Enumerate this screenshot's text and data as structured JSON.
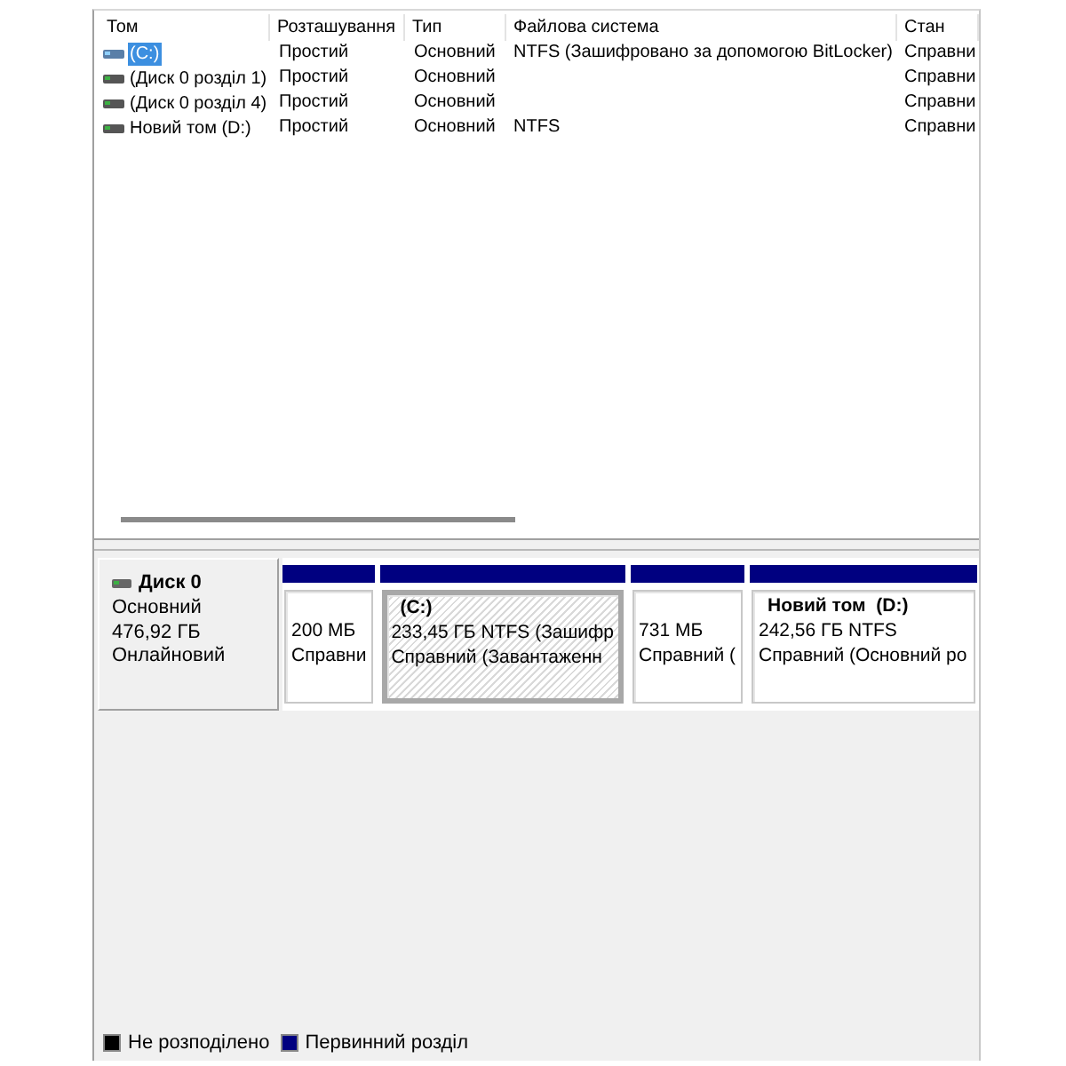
{
  "table": {
    "columns": [
      "Том",
      "Розташування",
      "Тип",
      "Файлова система",
      "Стан"
    ],
    "rows": [
      {
        "volume": "(C:)",
        "layout": "Простий",
        "type": "Основний",
        "file_system": "NTFS (Зашифровано за допомогою BitLocker)",
        "status": "Справни",
        "selected": true
      },
      {
        "volume": "(Диск 0 розділ 1)",
        "layout": "Простий",
        "type": "Основний",
        "status": "Справни",
        "selected": false
      },
      {
        "volume": "(Диск 0 розділ 4)",
        "layout": "Простий",
        "type": "Основний",
        "status": "Справни",
        "selected": false
      },
      {
        "volume": "Новий том (D:)",
        "layout": "Простий",
        "type": "Основний",
        "file_system": "NTFS",
        "status": "Справни",
        "selected": false
      }
    ]
  },
  "disks": [
    {
      "name": "Диск 0",
      "type": "Основний",
      "size": "476,92 ГБ",
      "state": "Онлайновий",
      "partitions": [
        {
          "lines": [
            "200 МБ",
            "Справни"
          ],
          "selected": false
        },
        {
          "title": "(C:)",
          "lines": [
            "233,45 ГБ NTFS (Зашифр",
            "Справний (Завантаженн"
          ],
          "selected": true
        },
        {
          "lines": [
            "731 МБ",
            "Справний ("
          ],
          "selected": false
        },
        {
          "title": "Новий том  (D:)",
          "lines": [
            "242,56 ГБ NTFS",
            "Справний (Основний ро"
          ],
          "selected": false
        }
      ]
    }
  ],
  "legend": [
    {
      "label": "Не розподілено",
      "color": "#000000"
    },
    {
      "label": "Первинний розділ",
      "color": "#000080"
    }
  ]
}
